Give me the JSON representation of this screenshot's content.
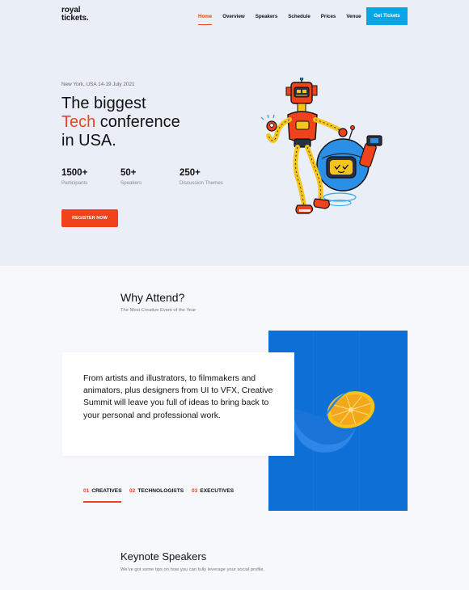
{
  "brand": {
    "line1": "royal",
    "line2": "tickets."
  },
  "nav": {
    "items": [
      {
        "label": "Home",
        "active": true
      },
      {
        "label": "Overview"
      },
      {
        "label": "Speakers"
      },
      {
        "label": "Schedule"
      },
      {
        "label": "Prices"
      },
      {
        "label": "Venue"
      }
    ],
    "cta_label": "Get Tickets"
  },
  "hero": {
    "location": "New York, USA 14-19 July 2021",
    "headline": {
      "line1": "The biggest",
      "accent": "Tech",
      "line2_rest": " conference",
      "line3": "in USA."
    },
    "stats": [
      {
        "value": "1500+",
        "label": "Participants"
      },
      {
        "value": "50+",
        "label": "Speakers"
      },
      {
        "value": "250+",
        "label": "Discussion Themes"
      }
    ],
    "register_label": "REGISTER NOW",
    "illustration_icon": "robot-illustration-icon"
  },
  "why": {
    "title": "Why Attend?",
    "subtitle": "The Most Creative Event of the Year",
    "body": "From artists and illustrators, to filmmakers and animators, plus designers from UI to VFX, Creative Summit will leave you full of ideas to bring back to your personal and professional work.",
    "tabs": [
      {
        "num": "01",
        "label": "CREATIVES",
        "active": true
      },
      {
        "num": "02",
        "label": "TECHNOLOGISTS"
      },
      {
        "num": "03",
        "label": "EXECUTIVES"
      }
    ],
    "image_icon": "orange-photo-icon"
  },
  "keynote": {
    "title": "Keynote Speakers",
    "subtitle": "We've got some tips on how you can fully leverage your social profile."
  },
  "colors": {
    "accent": "#f0431b",
    "cta": "#0aa5e6",
    "hero_bg": "#eaeef7",
    "photo_blue": "#0e6fd6"
  }
}
